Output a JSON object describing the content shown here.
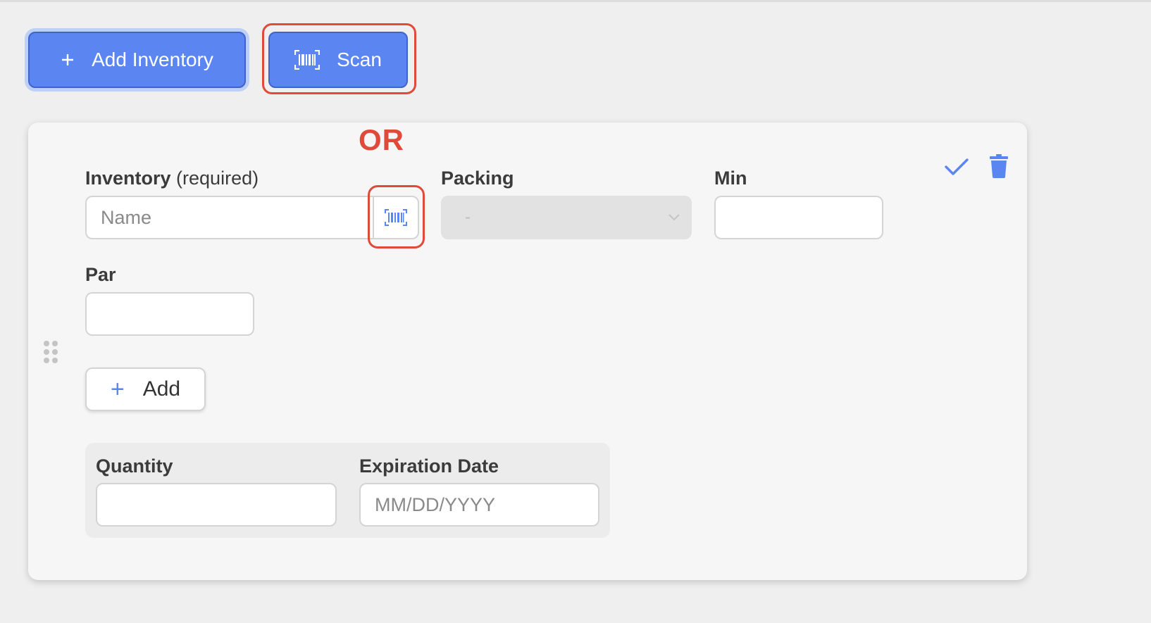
{
  "toolbar": {
    "add_inventory_label": "Add Inventory",
    "add_inventory_icon": "plus-icon",
    "scan_label": "Scan",
    "scan_icon": "barcode-scan-icon"
  },
  "annotation": {
    "or_text": "OR",
    "color": "#e04a3a"
  },
  "form": {
    "inventory_label": "Inventory",
    "inventory_required": "(required)",
    "inventory_placeholder": "Name",
    "inventory_value": "",
    "packing_label": "Packing",
    "packing_selected": "-",
    "min_label": "Min",
    "min_value": "",
    "par_label": "Par",
    "par_value": "",
    "add_label": "Add",
    "quantity_label": "Quantity",
    "quantity_value": "",
    "expiration_label": "Expiration Date",
    "expiration_placeholder": "MM/DD/YYYY",
    "expiration_value": ""
  },
  "colors": {
    "accent": "#5b86f2",
    "accent_border": "#3f63c9",
    "background": "#efefef",
    "card": "#f6f6f6"
  },
  "icons": {
    "confirm": "check-icon",
    "delete": "trash-icon",
    "drag": "drag-handle-icon"
  }
}
